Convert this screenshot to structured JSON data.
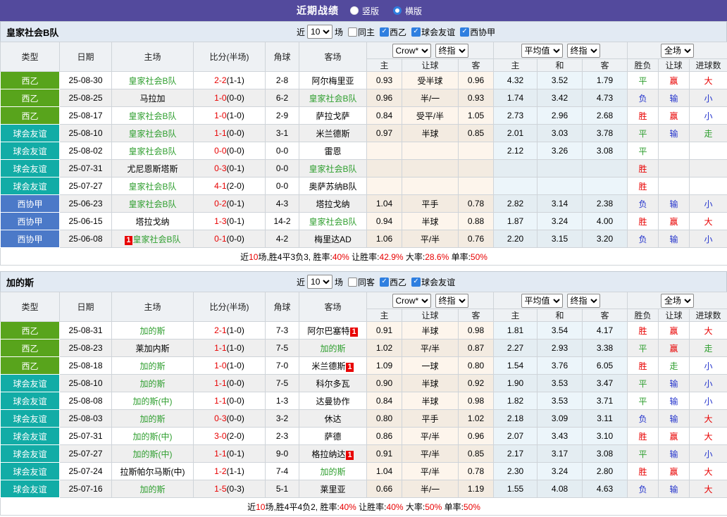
{
  "topbar": {
    "title": "近期战绩",
    "radios": [
      {
        "label": "竖版",
        "checked": false
      },
      {
        "label": "横版",
        "checked": true
      }
    ]
  },
  "colors": {
    "topbar_bg": "#534a9d",
    "accent_blue": "#2f7fe0",
    "focal_team_green": "#2e9e2e",
    "score_red": "#e80000",
    "type_colors": {
      "西乙": "#58a41c",
      "球会友谊": "#12aca6",
      "西协甲": "#4b79c8"
    },
    "result_colors": {
      "胜": "#e80000",
      "赢": "#e80000",
      "大": "#e80000",
      "平": "#2e9e2e",
      "走": "#2e9e2e",
      "负": "#2333cc",
      "输": "#2333cc",
      "小": "#2333cc"
    }
  },
  "columns": {
    "left": [
      "类型",
      "日期",
      "主场",
      "比分(半场)",
      "角球",
      "客场"
    ],
    "groups": [
      {
        "selects": [
          "Crow*",
          "终指"
        ]
      },
      {
        "selects": [
          "平均值",
          "终指"
        ]
      },
      {
        "selects": [
          "全场"
        ]
      }
    ],
    "sub": [
      "主",
      "让球",
      "客",
      "主",
      "和",
      "客",
      "胜负",
      "让球",
      "进球数"
    ]
  },
  "tables": [
    {
      "team": "皇家社会B队",
      "filter": {
        "near_label": "近",
        "count": "10",
        "unit_label": "场",
        "checkboxes": [
          {
            "label": "同主",
            "checked": false
          },
          {
            "label": "西乙",
            "checked": true
          },
          {
            "label": "球会友谊",
            "checked": true
          },
          {
            "label": "西协甲",
            "checked": true
          }
        ]
      },
      "rows": [
        {
          "type": "西乙",
          "date": "25-08-30",
          "home": "皇家社会B队",
          "hf": 1,
          "hb": "",
          "score": "2-2",
          "half": "(1-1)",
          "corner": "2-8",
          "away": "阿尔梅里亚",
          "af": 0,
          "ab": "",
          "odds": [
            "0.93",
            "受半球",
            "0.96"
          ],
          "avg": [
            "4.32",
            "3.52",
            "1.79"
          ],
          "res": [
            "平",
            "赢",
            "大"
          ]
        },
        {
          "type": "西乙",
          "date": "25-08-25",
          "home": "马拉加",
          "hf": 0,
          "hb": "",
          "score": "1-0",
          "half": "(0-0)",
          "corner": "6-2",
          "away": "皇家社会B队",
          "af": 1,
          "ab": "",
          "odds": [
            "0.96",
            "半/一",
            "0.93"
          ],
          "avg": [
            "1.74",
            "3.42",
            "4.73"
          ],
          "res": [
            "负",
            "输",
            "小"
          ]
        },
        {
          "type": "西乙",
          "date": "25-08-17",
          "home": "皇家社会B队",
          "hf": 1,
          "hb": "",
          "score": "1-0",
          "half": "(1-0)",
          "corner": "2-9",
          "away": "萨拉戈萨",
          "af": 0,
          "ab": "",
          "odds": [
            "0.84",
            "受平/半",
            "1.05"
          ],
          "avg": [
            "2.73",
            "2.96",
            "2.68"
          ],
          "res": [
            "胜",
            "赢",
            "小"
          ]
        },
        {
          "type": "球会友谊",
          "date": "25-08-10",
          "home": "皇家社会B队",
          "hf": 1,
          "hb": "",
          "score": "1-1",
          "half": "(0-0)",
          "corner": "3-1",
          "away": "米兰德斯",
          "af": 0,
          "ab": "",
          "odds": [
            "0.97",
            "半球",
            "0.85"
          ],
          "avg": [
            "2.01",
            "3.03",
            "3.78"
          ],
          "res": [
            "平",
            "输",
            "走"
          ]
        },
        {
          "type": "球会友谊",
          "date": "25-08-02",
          "home": "皇家社会B队",
          "hf": 1,
          "hb": "",
          "score": "0-0",
          "half": "(0-0)",
          "corner": "0-0",
          "away": "雷恩",
          "af": 0,
          "ab": "",
          "odds": [
            "",
            "",
            ""
          ],
          "avg": [
            "2.12",
            "3.26",
            "3.08"
          ],
          "res": [
            "平",
            "",
            ""
          ]
        },
        {
          "type": "球会友谊",
          "date": "25-07-31",
          "home": "尤尼恩斯塔斯",
          "hf": 0,
          "hb": "",
          "score": "0-3",
          "half": "(0-1)",
          "corner": "0-0",
          "away": "皇家社会B队",
          "af": 1,
          "ab": "",
          "odds": [
            "",
            "",
            ""
          ],
          "avg": [
            "",
            "",
            ""
          ],
          "res": [
            "胜",
            "",
            ""
          ]
        },
        {
          "type": "球会友谊",
          "date": "25-07-27",
          "home": "皇家社会B队",
          "hf": 1,
          "hb": "",
          "score": "4-1",
          "half": "(2-0)",
          "corner": "0-0",
          "away": "奥萨苏纳B队",
          "af": 0,
          "ab": "",
          "odds": [
            "",
            "",
            ""
          ],
          "avg": [
            "",
            "",
            ""
          ],
          "res": [
            "胜",
            "",
            ""
          ]
        },
        {
          "type": "西协甲",
          "date": "25-06-23",
          "home": "皇家社会B队",
          "hf": 1,
          "hb": "",
          "score": "0-2",
          "half": "(0-1)",
          "corner": "4-3",
          "away": "塔拉戈纳",
          "af": 0,
          "ab": "",
          "odds": [
            "1.04",
            "平手",
            "0.78"
          ],
          "avg": [
            "2.82",
            "3.14",
            "2.38"
          ],
          "res": [
            "负",
            "输",
            "小"
          ]
        },
        {
          "type": "西协甲",
          "date": "25-06-15",
          "home": "塔拉戈纳",
          "hf": 0,
          "hb": "",
          "score": "1-3",
          "half": "(0-1)",
          "corner": "14-2",
          "away": "皇家社会B队",
          "af": 1,
          "ab": "",
          "odds": [
            "0.94",
            "半球",
            "0.88"
          ],
          "avg": [
            "1.87",
            "3.24",
            "4.00"
          ],
          "res": [
            "胜",
            "赢",
            "大"
          ]
        },
        {
          "type": "西协甲",
          "date": "25-06-08",
          "home": "皇家社会B队",
          "hf": 1,
          "hb": "1",
          "score": "0-1",
          "half": "(0-0)",
          "corner": "4-2",
          "away": "梅里达AD",
          "af": 0,
          "ab": "",
          "odds": [
            "1.06",
            "平/半",
            "0.76"
          ],
          "avg": [
            "2.20",
            "3.15",
            "3.20"
          ],
          "res": [
            "负",
            "输",
            "小"
          ]
        }
      ],
      "summary": [
        [
          "近",
          0
        ],
        [
          "10",
          1
        ],
        [
          "场,胜4平3负3, 胜率:",
          0
        ],
        [
          "40%",
          1
        ],
        [
          " 让胜率:",
          0
        ],
        [
          "42.9%",
          1
        ],
        [
          " 大率:",
          0
        ],
        [
          "28.6%",
          1
        ],
        [
          " 单率:",
          0
        ],
        [
          "50%",
          1
        ]
      ]
    },
    {
      "team": "加的斯",
      "filter": {
        "near_label": "近",
        "count": "10",
        "unit_label": "场",
        "checkboxes": [
          {
            "label": "同客",
            "checked": false
          },
          {
            "label": "西乙",
            "checked": true
          },
          {
            "label": "球会友谊",
            "checked": true
          }
        ]
      },
      "rows": [
        {
          "type": "西乙",
          "date": "25-08-31",
          "home": "加的斯",
          "hf": 1,
          "hb": "",
          "score": "2-1",
          "half": "(1-0)",
          "corner": "7-3",
          "away": "阿尔巴塞特",
          "af": 0,
          "ab": "1",
          "odds": [
            "0.91",
            "半球",
            "0.98"
          ],
          "avg": [
            "1.81",
            "3.54",
            "4.17"
          ],
          "res": [
            "胜",
            "赢",
            "大"
          ]
        },
        {
          "type": "西乙",
          "date": "25-08-23",
          "home": "莱加内斯",
          "hf": 0,
          "hb": "",
          "score": "1-1",
          "half": "(1-0)",
          "corner": "7-5",
          "away": "加的斯",
          "af": 1,
          "ab": "",
          "odds": [
            "1.02",
            "平/半",
            "0.87"
          ],
          "avg": [
            "2.27",
            "2.93",
            "3.38"
          ],
          "res": [
            "平",
            "赢",
            "走"
          ]
        },
        {
          "type": "西乙",
          "date": "25-08-18",
          "home": "加的斯",
          "hf": 1,
          "hb": "",
          "score": "1-0",
          "half": "(1-0)",
          "corner": "7-0",
          "away": "米兰德斯",
          "af": 0,
          "ab": "1",
          "odds": [
            "1.09",
            "一球",
            "0.80"
          ],
          "avg": [
            "1.54",
            "3.76",
            "6.05"
          ],
          "res": [
            "胜",
            "走",
            "小"
          ]
        },
        {
          "type": "球会友谊",
          "date": "25-08-10",
          "home": "加的斯",
          "hf": 1,
          "hb": "",
          "score": "1-1",
          "half": "(0-0)",
          "corner": "7-5",
          "away": "科尔多瓦",
          "af": 0,
          "ab": "",
          "odds": [
            "0.90",
            "半球",
            "0.92"
          ],
          "avg": [
            "1.90",
            "3.53",
            "3.47"
          ],
          "res": [
            "平",
            "输",
            "小"
          ]
        },
        {
          "type": "球会友谊",
          "date": "25-08-08",
          "home": "加的斯(中)",
          "hf": 1,
          "hb": "",
          "score": "1-1",
          "half": "(0-0)",
          "corner": "1-3",
          "away": "达曼协作",
          "af": 0,
          "ab": "",
          "odds": [
            "0.84",
            "半球",
            "0.98"
          ],
          "avg": [
            "1.82",
            "3.53",
            "3.71"
          ],
          "res": [
            "平",
            "输",
            "小"
          ]
        },
        {
          "type": "球会友谊",
          "date": "25-08-03",
          "home": "加的斯",
          "hf": 1,
          "hb": "",
          "score": "0-3",
          "half": "(0-0)",
          "corner": "3-2",
          "away": "休达",
          "af": 0,
          "ab": "",
          "odds": [
            "0.80",
            "平手",
            "1.02"
          ],
          "avg": [
            "2.18",
            "3.09",
            "3.11"
          ],
          "res": [
            "负",
            "输",
            "大"
          ]
        },
        {
          "type": "球会友谊",
          "date": "25-07-31",
          "home": "加的斯(中)",
          "hf": 1,
          "hb": "",
          "score": "3-0",
          "half": "(2-0)",
          "corner": "2-3",
          "away": "萨德",
          "af": 0,
          "ab": "",
          "odds": [
            "0.86",
            "平/半",
            "0.96"
          ],
          "avg": [
            "2.07",
            "3.43",
            "3.10"
          ],
          "res": [
            "胜",
            "赢",
            "大"
          ]
        },
        {
          "type": "球会友谊",
          "date": "25-07-27",
          "home": "加的斯(中)",
          "hf": 1,
          "hb": "",
          "score": "1-1",
          "half": "(0-1)",
          "corner": "9-0",
          "away": "格拉纳达",
          "af": 0,
          "ab": "1",
          "odds": [
            "0.91",
            "平/半",
            "0.85"
          ],
          "avg": [
            "2.17",
            "3.17",
            "3.08"
          ],
          "res": [
            "平",
            "输",
            "小"
          ]
        },
        {
          "type": "球会友谊",
          "date": "25-07-24",
          "home": "拉斯帕尔马斯(中)",
          "hf": 0,
          "hb": "",
          "score": "1-2",
          "half": "(1-1)",
          "corner": "7-4",
          "away": "加的斯",
          "af": 1,
          "ab": "",
          "odds": [
            "1.04",
            "平/半",
            "0.78"
          ],
          "avg": [
            "2.30",
            "3.24",
            "2.80"
          ],
          "res": [
            "胜",
            "赢",
            "大"
          ]
        },
        {
          "type": "球会友谊",
          "date": "25-07-16",
          "home": "加的斯",
          "hf": 1,
          "hb": "",
          "score": "1-5",
          "half": "(0-3)",
          "corner": "5-1",
          "away": "莱里亚",
          "af": 0,
          "ab": "",
          "odds": [
            "0.66",
            "半/一",
            "1.19"
          ],
          "avg": [
            "1.55",
            "4.08",
            "4.63"
          ],
          "res": [
            "负",
            "输",
            "大"
          ]
        }
      ],
      "summary": [
        [
          "近",
          0
        ],
        [
          "10",
          1
        ],
        [
          "场,胜4平4负2, 胜率:",
          0
        ],
        [
          "40%",
          1
        ],
        [
          " 让胜率:",
          0
        ],
        [
          "40%",
          1
        ],
        [
          " 大率:",
          0
        ],
        [
          "50%",
          1
        ],
        [
          " 单率:",
          0
        ],
        [
          "50%",
          1
        ]
      ]
    }
  ]
}
